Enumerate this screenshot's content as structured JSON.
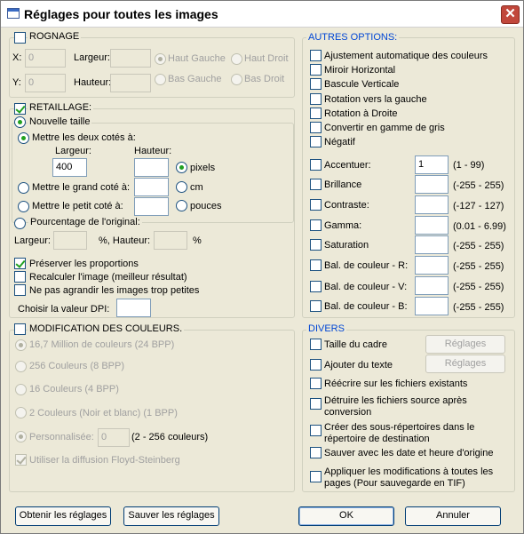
{
  "window": {
    "title": "Réglages pour toutes les images",
    "close": "✕"
  },
  "crop": {
    "label": "ROGNAGE",
    "x_label": "X:",
    "x_value": "0",
    "y_label": "Y:",
    "y_value": "0",
    "width_label": "Largeur:",
    "height_label": "Hauteur:",
    "anchor_top_left": "Haut Gauche",
    "anchor_top_right": "Haut Droit",
    "anchor_bottom_left": "Bas Gauche",
    "anchor_bottom_right": "Bas Droit"
  },
  "resize": {
    "label": "RETAILLAGE:",
    "new_size": "Nouvelle taille",
    "both_sides": "Mettre les deux cotés à:",
    "width_label": "Largeur:",
    "height_label": "Hauteur:",
    "width_value": "400",
    "height_value": "",
    "unit_pixels": "pixels",
    "unit_cm": "cm",
    "unit_inches": "pouces",
    "large_side": "Mettre le grand coté à:",
    "small_side": "Mettre le petit coté à:",
    "percentage": "Pourcentage de l'original:",
    "pct_width_label": "Largeur:",
    "pct_unit_1": "%, Hauteur:",
    "pct_unit_2": "%",
    "keep_proportions": "Préserver les proportions",
    "recompute": "Recalculer l'image (meilleur résultat)",
    "no_enlarge": "Ne pas agrandir les images trop petites",
    "dpi_label": "Choisir la valeur DPI:",
    "dpi_value": ""
  },
  "colors": {
    "label": "MODIFICATION DES COULEURS.",
    "opt_24bpp": "16,7 Million de couleurs (24 BPP)",
    "opt_8bpp": "256 Couleurs (8 BPP)",
    "opt_4bpp": "16 Couleurs (4 BPP)",
    "opt_1bpp": "2 Couleurs (Noir et blanc) (1 BPP)",
    "opt_custom": "Personnalisée:",
    "custom_value": "0",
    "custom_range": "(2 - 256 couleurs)",
    "floyd": "Utiliser la diffusion Floyd-Steinberg"
  },
  "other": {
    "label": "AUTRES OPTIONS:",
    "auto_colors": "Ajustement automatique des couleurs",
    "mirror": "Miroir Horizontal",
    "flip": "Bascule Verticale",
    "rotate_left": "Rotation vers la gauche",
    "rotate_right": "Rotation à Droite",
    "grayscale": "Convertir en gamme de gris",
    "negative": "Négatif",
    "sharpen": "Accentuer:",
    "sharpen_value": "1",
    "sharpen_range": "(1 - 99)",
    "brightness": "Brillance",
    "brightness_range": "(-255 - 255)",
    "contrast": "Contraste:",
    "contrast_range": "(-127 - 127)",
    "gamma": "Gamma:",
    "gamma_range": "(0.01 - 6.99)",
    "saturation": "Saturation",
    "saturation_range": "(-255  -  255)",
    "bal_r": "Bal. de couleur - R:",
    "bal_r_range": "(-255  -  255)",
    "bal_v": "Bal. de couleur - V:",
    "bal_v_range": "(-255  -  255)",
    "bal_b": "Bal. de couleur - B:",
    "bal_b_range": "(-255  -  255)"
  },
  "misc": {
    "label": "DIVERS",
    "frame_size": "Taille du cadre",
    "settings_btn_1": "Réglages",
    "add_text": "Ajouter du texte",
    "settings_btn_2": "Réglages",
    "overwrite": "Réécrire sur les fichiers existants",
    "delete_src_1": "Détruire les fichiers source après",
    "delete_src_2": "conversion",
    "create_sub_1": "Créer des sous-répertoires dans le",
    "create_sub_2": "répertoire de destination",
    "save_date": "Sauver  avec les date et heure d'origine",
    "apply_all_1": "Appliquer les modifications à toutes les",
    "apply_all_2": "pages (Pour sauvegarde en TIF)"
  },
  "footer": {
    "get_settings": "Obtenir les réglages",
    "save_settings": "Sauver les réglages",
    "ok": "OK",
    "cancel": "Annuler"
  }
}
